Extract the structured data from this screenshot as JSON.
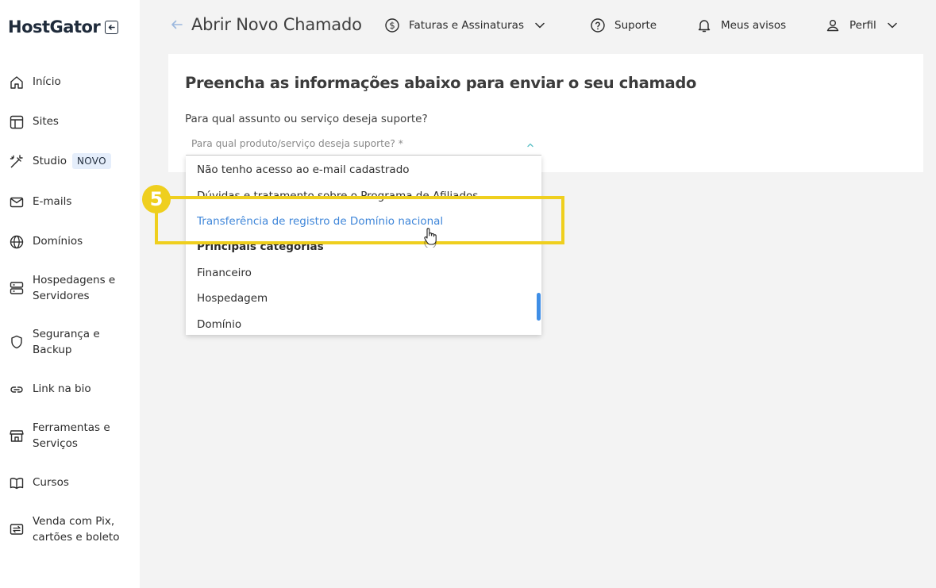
{
  "brand": {
    "logo_text": "HostGator"
  },
  "sidebar": {
    "items": [
      {
        "label": "Início",
        "icon": "home-icon"
      },
      {
        "label": "Sites",
        "icon": "layout-icon"
      },
      {
        "label": "Studio",
        "icon": "magic-wand-icon",
        "badge": "NOVO"
      },
      {
        "label": "E-mails",
        "icon": "mail-icon"
      },
      {
        "label": "Domínios",
        "icon": "globe-icon"
      },
      {
        "label": "Hospedagens e Servidores",
        "line1": "Hospedagens e",
        "line2": "Servidores",
        "icon": "server-icon"
      },
      {
        "label": "Segurança e Backup",
        "line1": "Segurança e",
        "line2": "Backup",
        "icon": "shield-icon"
      },
      {
        "label": "Link na bio",
        "icon": "link-icon"
      },
      {
        "label": "Ferramentas e Serviços",
        "line1": "Ferramentas e",
        "line2": "Serviços",
        "icon": "store-icon"
      },
      {
        "label": "Cursos",
        "icon": "book-icon"
      },
      {
        "label": "Venda com Pix, cartões e boleto",
        "line1": "Venda com Pix,",
        "line2": "cartões e boleto",
        "icon": "exchange-icon"
      }
    ]
  },
  "header": {
    "title": "Abrir Novo Chamado",
    "billing": "Faturas e Assinaturas",
    "support": "Suporte",
    "notices": "Meus avisos",
    "profile": "Perfil"
  },
  "form": {
    "heading": "Preencha as informações abaixo para enviar o seu chamado",
    "question": "Para qual assunto ou serviço deseja suporte?",
    "select_placeholder": "Para qual produto/serviço deseja suporte? *"
  },
  "dropdown": {
    "options": [
      "Não tenho acesso ao e-mail cadastrado",
      "Dúvidas e tratamento sobre o Programa de Afiliados",
      "Transferência de registro de Domínio nacional"
    ],
    "group_label": "Principais categorias",
    "categories": [
      "Financeiro",
      "Hospedagem",
      "Domínio"
    ],
    "highlight_color": "#3f86d9"
  },
  "annotation": {
    "step": "5",
    "color": "#efcf1e"
  }
}
